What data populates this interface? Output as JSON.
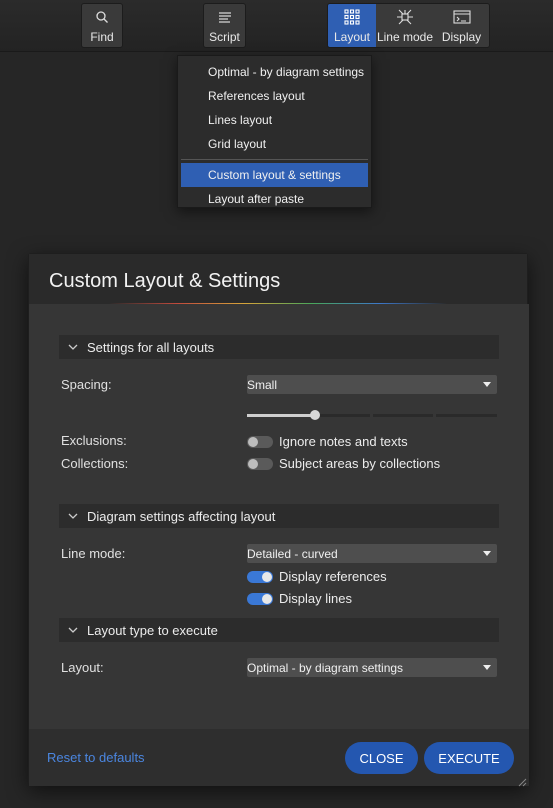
{
  "toolbar": {
    "find_label": "Find",
    "script_label": "Script",
    "layout_label": "Layout",
    "line_mode_label": "Line mode",
    "display_label": "Display"
  },
  "layout_menu": {
    "items": [
      "Optimal - by diagram settings",
      "References layout",
      "Lines layout",
      "Grid layout"
    ],
    "selected": "Custom layout & settings",
    "after": "Layout after paste"
  },
  "dialog": {
    "title": "Custom Layout & Settings",
    "section1": {
      "title": "Settings for all layouts",
      "spacing_label": "Spacing:",
      "spacing_value": "Small",
      "spacing_slider_level": 0.27,
      "exclusions_label": "Exclusions:",
      "exclusions_toggle_label": "Ignore notes and texts",
      "exclusions_on": false,
      "collections_label": "Collections:",
      "collections_toggle_label": "Subject areas by collections",
      "collections_on": false
    },
    "section2": {
      "title": "Diagram settings affecting layout",
      "line_mode_label": "Line mode:",
      "line_mode_value": "Detailed - curved",
      "display_references_label": "Display references",
      "display_references_on": true,
      "display_lines_label": "Display lines",
      "display_lines_on": true
    },
    "section3": {
      "title": "Layout type to execute",
      "layout_label": "Layout:",
      "layout_value": "Optimal - by diagram settings"
    },
    "footer": {
      "reset_label": "Reset to defaults",
      "close_label": "CLOSE",
      "execute_label": "EXECUTE"
    }
  },
  "colors": {
    "accent": "#2f5fb3",
    "button": "#2457b0",
    "link": "#4b86e0",
    "toggle_on": "#3a78d6"
  }
}
